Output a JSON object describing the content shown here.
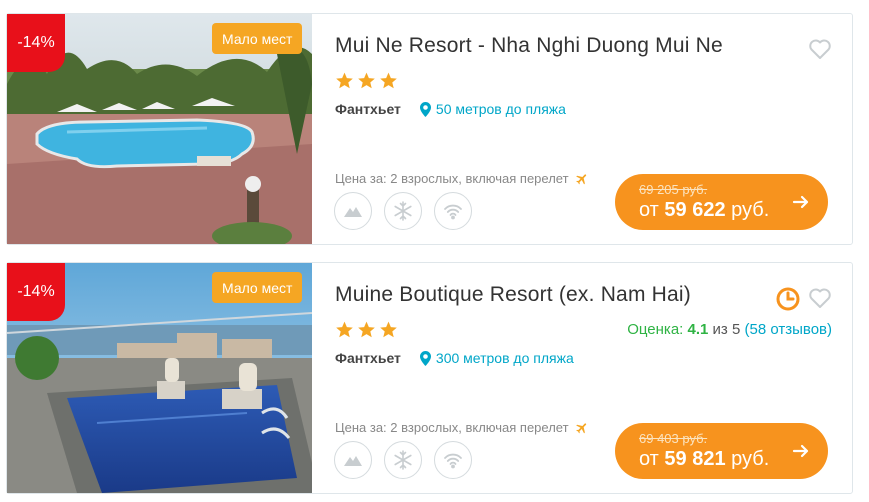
{
  "hotels": [
    {
      "discount": "-14%",
      "availability_badge": "Мало мест",
      "name": "Mui Ne Resort - Nha Nghi Duong Mui Ne",
      "stars": 3,
      "city": "Фантхьет",
      "beach_distance": "50 метров до пляжа",
      "price_note": "Цена за: 2 взрослых, включая перелет",
      "old_price": "69 205 руб.",
      "price_prefix": "от",
      "price_amount": "59 622",
      "price_currency": "руб.",
      "amenities": [
        "mountain-icon",
        "snowflake-icon",
        "wifi-icon"
      ]
    },
    {
      "discount": "-14%",
      "availability_badge": "Мало мест",
      "name": "Muine Boutique Resort (ex. Nam Hai)",
      "stars": 3,
      "city": "Фантхьет",
      "beach_distance": "300 метров до пляжа",
      "rating_label": "Оценка:",
      "rating_value": "4.1",
      "rating_of": "из 5",
      "rating_reviews": "(58 отзывов)",
      "price_note": "Цена за: 2 взрослых, включая перелет",
      "old_price": "69 403 руб.",
      "price_prefix": "от",
      "price_amount": "59 821",
      "price_currency": "руб.",
      "amenities": [
        "mountain-icon",
        "snowflake-icon",
        "wifi-icon"
      ]
    }
  ],
  "colors": {
    "discount": "#e8101a",
    "badge": "#f5a623",
    "price_button": "#f7931e",
    "star": "#f5a623",
    "link": "#00a6c8",
    "rating": "#2fb344"
  }
}
